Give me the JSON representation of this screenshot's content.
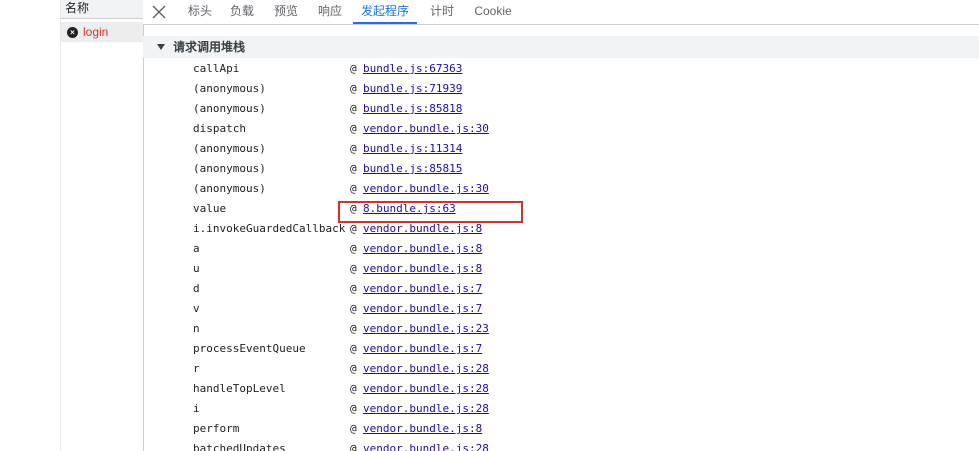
{
  "requests_panel": {
    "header": "名称",
    "items": [
      {
        "name": "login",
        "status": "error"
      }
    ]
  },
  "tabs": [
    {
      "label": "标头",
      "active": false
    },
    {
      "label": "负载",
      "active": false
    },
    {
      "label": "预览",
      "active": false
    },
    {
      "label": "响应",
      "active": false
    },
    {
      "label": "发起程序",
      "active": true
    },
    {
      "label": "计时",
      "active": false
    },
    {
      "label": "Cookie",
      "active": false
    }
  ],
  "section_title": "请求调用堆栈",
  "frames": [
    {
      "fn": "callApi",
      "at": "@",
      "loc": "bundle.js:67363"
    },
    {
      "fn": "(anonymous)",
      "at": "@",
      "loc": "bundle.js:71939"
    },
    {
      "fn": "(anonymous)",
      "at": "@",
      "loc": "bundle.js:85818"
    },
    {
      "fn": "dispatch",
      "at": "@",
      "loc": "vendor.bundle.js:30"
    },
    {
      "fn": "(anonymous)",
      "at": "@",
      "loc": "bundle.js:11314"
    },
    {
      "fn": "(anonymous)",
      "at": "@",
      "loc": "bundle.js:85815"
    },
    {
      "fn": "(anonymous)",
      "at": "@",
      "loc": "vendor.bundle.js:30"
    },
    {
      "fn": "value",
      "at": "@",
      "loc": "8.bundle.js:63"
    },
    {
      "fn": "i.invokeGuardedCallback",
      "at": "@",
      "loc": "vendor.bundle.js:8"
    },
    {
      "fn": "a",
      "at": "@",
      "loc": "vendor.bundle.js:8"
    },
    {
      "fn": "u",
      "at": "@",
      "loc": "vendor.bundle.js:8"
    },
    {
      "fn": "d",
      "at": "@",
      "loc": "vendor.bundle.js:7"
    },
    {
      "fn": "v",
      "at": "@",
      "loc": "vendor.bundle.js:7"
    },
    {
      "fn": "n",
      "at": "@",
      "loc": "vendor.bundle.js:23"
    },
    {
      "fn": "processEventQueue",
      "at": "@",
      "loc": "vendor.bundle.js:7"
    },
    {
      "fn": "r",
      "at": "@",
      "loc": "vendor.bundle.js:28"
    },
    {
      "fn": "handleTopLevel",
      "at": "@",
      "loc": "vendor.bundle.js:28"
    },
    {
      "fn": "i",
      "at": "@",
      "loc": "vendor.bundle.js:28"
    },
    {
      "fn": "perform",
      "at": "@",
      "loc": "vendor.bundle.js:8"
    },
    {
      "fn": "batchedUpdates",
      "at": "@",
      "loc": "vendor.bundle.js:28"
    }
  ],
  "colors": {
    "active_tab": "#1a73e8",
    "error": "#d93025",
    "link": "#1a0dab",
    "highlight": "#d93025"
  },
  "icons": {
    "close": "close-icon",
    "error": "error-icon",
    "collapse": "triangle-down-icon"
  }
}
